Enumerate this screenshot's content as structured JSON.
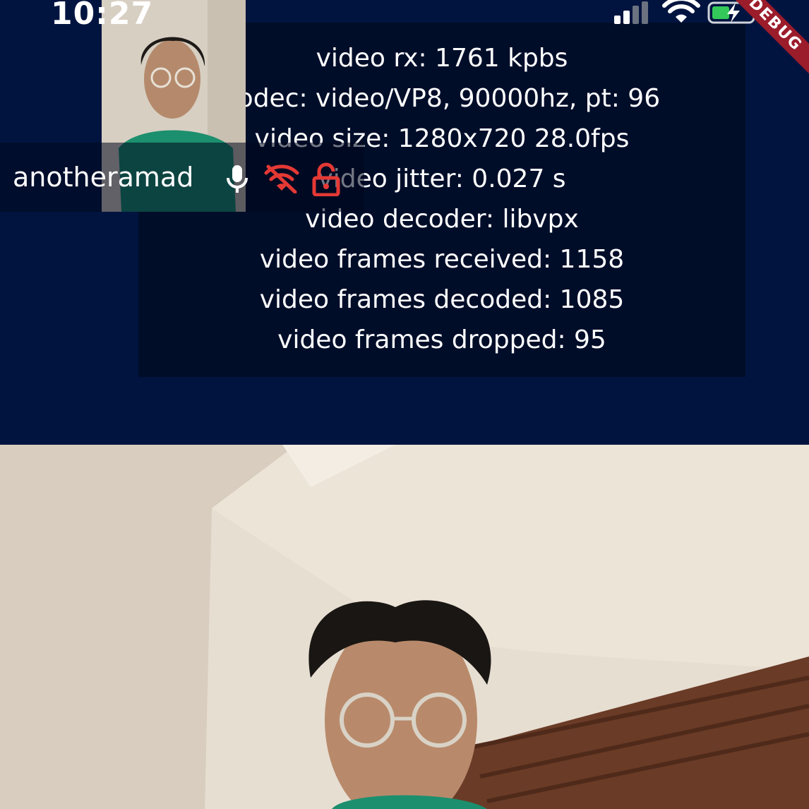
{
  "status_bar": {
    "time": "10:27"
  },
  "debug_banner": {
    "label": "DEBUG"
  },
  "stats": {
    "lines": [
      "video rx: 1761 kpbs",
      "codec: video/VP8, 90000hz, pt: 96",
      "video size: 1280x720 28.0fps",
      "video jitter: 0.027 s",
      "video decoder: libvpx",
      "video frames received: 1158",
      "video frames decoded: 1085",
      "video frames dropped: 95"
    ]
  },
  "participant": {
    "name": "anotheramad",
    "icons": [
      "mic-icon",
      "wifi-off-icon",
      "lock-open-icon"
    ]
  },
  "colors": {
    "background": "#00143f",
    "alert_red": "#e53935",
    "banner": "#9b1c2a"
  }
}
